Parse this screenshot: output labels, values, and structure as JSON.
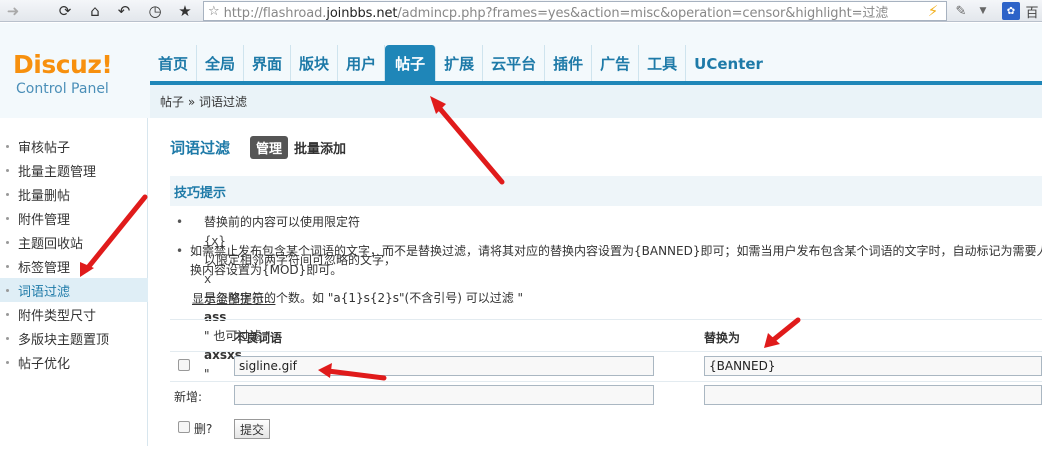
{
  "browser": {
    "url_prefix": "http://flashroad.",
    "url_domain": "joinbbs.net",
    "url_suffix": "/admincp.php?frames=yes&action=misc&operation=censor&highlight=过滤",
    "tab_partial": "百"
  },
  "header": {
    "logo_text": "Discuz!",
    "logo_subtitle": "Control Panel",
    "nav": [
      "首页",
      "全局",
      "界面",
      "版块",
      "用户",
      "帖子",
      "扩展",
      "云平台",
      "插件",
      "广告",
      "工具",
      "UCenter"
    ],
    "active_nav": "帖子",
    "breadcrumb": "帖子 » 词语过滤"
  },
  "sidebar": {
    "items": [
      {
        "label": "审核帖子"
      },
      {
        "label": "批量主题管理"
      },
      {
        "label": "批量删帖"
      },
      {
        "label": "附件管理"
      },
      {
        "label": "主题回收站"
      },
      {
        "label": "标签管理"
      },
      {
        "label": "词语过滤"
      },
      {
        "label": "附件类型尺寸"
      },
      {
        "label": "多版块主题置顶"
      },
      {
        "label": "帖子优化"
      }
    ],
    "active": "词语过滤"
  },
  "main": {
    "title": "词语过滤",
    "tab_manage": "管理",
    "tab_batch": "批量添加",
    "tips_title": "技巧提示",
    "tip1_a": "替换前的内容可以使用限定符",
    "tip1_code": "{x}",
    "tip1_b": "以限定相邻两字符间可忽略的文字，",
    "tip1_x": "x",
    "tip1_c": "是忽略字符的个数。如 \"a{1}s{2}s\"(不含引号) 可以过滤 \"",
    "tip1_ass": "ass",
    "tip1_d": "\" 也可过滤 \"",
    "tip1_axsxs": "axsxs",
    "tip1_e": "\"",
    "tip2_line1": "如需禁止发布包含某个词语的文字，而不是替换过滤，请将其对应的替换内容设置为{BANNED}即可；如需当用户发布包含某个词语的文字时，自动标记为需要人",
    "tip2_line2": "换内容设置为{MOD}即可。",
    "show_all": "显示全部提示...",
    "col_word": "不良词语",
    "col_replace": "替换为",
    "rows": [
      {
        "word": "sigline.gif",
        "replace": "{BANNED}"
      }
    ],
    "new_label": "新增:",
    "new_word": "",
    "new_replace": "",
    "delete_label": "删?",
    "submit_label": "提交"
  }
}
